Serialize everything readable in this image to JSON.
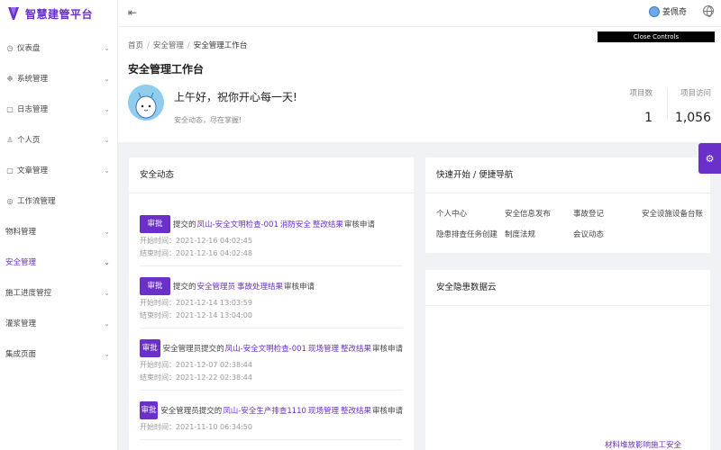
{
  "app": {
    "title": "智慧建管平台"
  },
  "sidebar": {
    "items": [
      {
        "label": "仪表盘",
        "icon": "dashboard-icon",
        "glyph": "◷",
        "arrow": true
      },
      {
        "label": "系统管理",
        "icon": "settings-icon",
        "glyph": "❉",
        "arrow": true
      },
      {
        "label": "日志管理",
        "icon": "log-icon",
        "glyph": "▢",
        "arrow": true
      },
      {
        "label": "个人页",
        "icon": "user-icon",
        "glyph": "♙",
        "arrow": true
      },
      {
        "label": "文章管理",
        "icon": "article-icon",
        "glyph": "▢",
        "arrow": true
      },
      {
        "label": "工作流管理",
        "icon": "workflow-icon",
        "glyph": "◎",
        "arrow": false
      },
      {
        "label": "物料管理",
        "icon": "",
        "glyph": "",
        "arrow": true
      },
      {
        "label": "安全管理",
        "icon": "",
        "glyph": "",
        "arrow": true,
        "active": true
      },
      {
        "label": "施工进度管控",
        "icon": "",
        "glyph": "",
        "arrow": true
      },
      {
        "label": "灌浆管理",
        "icon": "",
        "glyph": "",
        "arrow": true
      },
      {
        "label": "集成页面",
        "icon": "",
        "glyph": "",
        "arrow": true
      }
    ]
  },
  "header": {
    "user_name": "姜佩奇"
  },
  "overlay": {
    "close_controls": "Close Controls"
  },
  "breadcrumb": {
    "home": "首页",
    "parent": "安全管理",
    "current": "安全管理工作台"
  },
  "page": {
    "title": "安全管理工作台",
    "greeting": "上午好，祝你开心每一天!",
    "greeting_sub": "安全动态，尽在掌握!",
    "stats": [
      {
        "label": "项目数",
        "value": "1"
      },
      {
        "label": "项目访问",
        "value": "1,056"
      }
    ]
  },
  "safety_feed": {
    "title": "安全动态",
    "items": [
      {
        "button": "审批",
        "segments": [
          {
            "text": "提交的",
            "style": "plain"
          },
          {
            "text": "凤山-安全文明检查-001",
            "style": "link"
          },
          {
            "text": "消防安全",
            "style": "link"
          },
          {
            "text": "整改结果",
            "style": "link"
          },
          {
            "text": "审核申请",
            "style": "plain"
          }
        ],
        "start": "开始时间：2021-12-16 04:02:45",
        "end": "结束时间：2021-12-16 04:02:48"
      },
      {
        "button": "审批",
        "segments": [
          {
            "text": "提交的",
            "style": "plain"
          },
          {
            "text": "安全管理员",
            "style": "link"
          },
          {
            "text": "事故处理结果",
            "style": "link"
          },
          {
            "text": "审核申请",
            "style": "plain"
          }
        ],
        "start": "开始时间：2021-12-14 13:03:59",
        "end": "结束时间：2021-12-14 13:04:00"
      },
      {
        "button": "审批",
        "segments": [
          {
            "text": "安全管理员",
            "style": "plain"
          },
          {
            "text": "提交的",
            "style": "plain"
          },
          {
            "text": "凤山-安全文明检查-001",
            "style": "link"
          },
          {
            "text": "现场管理",
            "style": "link"
          },
          {
            "text": "整改结果",
            "style": "link"
          },
          {
            "text": "审核申请",
            "style": "plain"
          }
        ],
        "start": "开始时间：2021-12-07 02:38:44",
        "end": "结束时间：2021-12-22 02:38:44"
      },
      {
        "button": "审批",
        "segments": [
          {
            "text": "安全管理员",
            "style": "plain"
          },
          {
            "text": "提交的",
            "style": "plain"
          },
          {
            "text": "凤山-安全生产排查1110",
            "style": "link"
          },
          {
            "text": "现场管理",
            "style": "link"
          },
          {
            "text": "整改结果",
            "style": "link"
          },
          {
            "text": "审核申请",
            "style": "plain"
          }
        ],
        "start": "开始时间：2021-11-10 06:34:50",
        "end": ""
      }
    ]
  },
  "quick_nav": {
    "title": "快速开始 / 便捷导航",
    "links": [
      "个人中心",
      "安全信息发布",
      "事故登记",
      "安全设施设备台账",
      "隐患排查任务创建",
      "制度法规",
      "会议动态"
    ]
  },
  "word_cloud": {
    "title": "安全隐患数据云",
    "words": [
      "材料堆放影响施工安全"
    ]
  },
  "colors": {
    "accent": "#6a30c9",
    "background": "#f0f2f5"
  }
}
